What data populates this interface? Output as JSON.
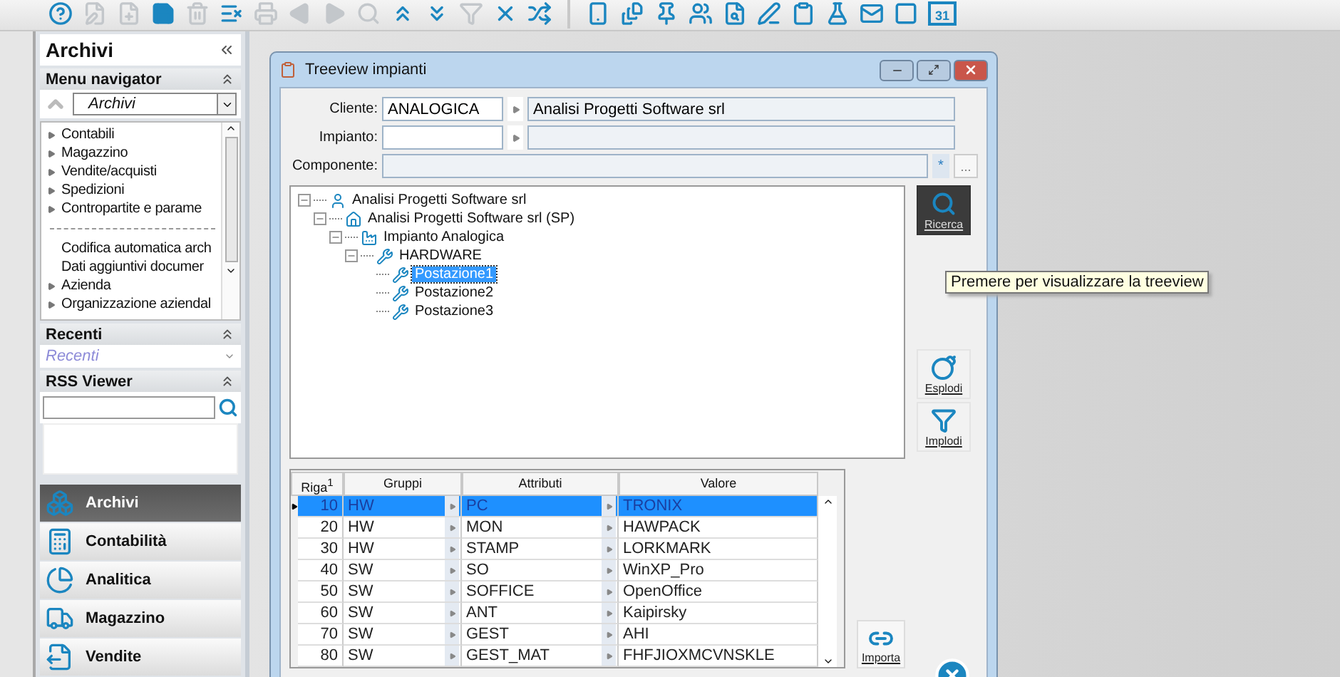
{
  "toolbar": [
    {
      "disabled": false
    },
    {
      "disabled": true
    },
    {
      "disabled": true
    },
    {
      "disabled": false
    },
    {
      "disabled": true
    },
    {
      "disabled": false
    },
    {
      "disabled": true
    },
    {
      "disabled": true
    },
    {
      "disabled": true
    },
    {
      "disabled": true
    },
    {
      "disabled": false
    },
    {
      "disabled": false
    },
    {
      "disabled": true
    },
    {
      "disabled": false
    },
    {
      "disabled": false
    },
    {
      "disabled": false
    },
    {
      "disabled": false
    },
    {
      "disabled": false
    },
    {
      "disabled": false
    },
    {
      "disabled": false
    },
    {
      "disabled": false
    },
    {
      "disabled": false
    },
    {
      "disabled": false
    },
    {
      "disabled": false
    },
    {
      "disabled": false
    }
  ],
  "toolbar_calendar_day": "31",
  "sidebar": {
    "title": "Archivi",
    "menu_navigator": {
      "title": "Menu navigator",
      "combo_value": "Archivi",
      "items": [
        {
          "label": "Contabili",
          "kind": "folder"
        },
        {
          "label": "Magazzino",
          "kind": "folder"
        },
        {
          "label": "Vendite/acquisti",
          "kind": "folder"
        },
        {
          "label": "Spedizioni",
          "kind": "folder"
        },
        {
          "label": "Contropartite e parame",
          "kind": "folder"
        },
        {
          "kind": "separator"
        },
        {
          "label": "Codifica automatica arch",
          "kind": "leaf"
        },
        {
          "label": "Dati aggiuntivi documer",
          "kind": "leaf"
        },
        {
          "label": "Azienda",
          "kind": "folder"
        },
        {
          "label": "Organizzazione aziendal",
          "kind": "folder"
        }
      ]
    },
    "recenti": {
      "title": "Recenti",
      "placeholder": "Recenti"
    },
    "rss": {
      "title": "RSS Viewer"
    },
    "nav": [
      {
        "label": "Archivi",
        "selected": true
      },
      {
        "label": "Contabilità",
        "selected": false
      },
      {
        "label": "Analitica",
        "selected": false
      },
      {
        "label": "Magazzino",
        "selected": false
      },
      {
        "label": "Vendite",
        "selected": false
      }
    ]
  },
  "dialog": {
    "title": "Treeview impianti",
    "fields": [
      {
        "label": "Cliente:",
        "kind": "lookup",
        "code": "ANALOGICA",
        "description": "Analisi Progetti Software srl"
      },
      {
        "label": "Impianto:",
        "kind": "lookup"
      },
      {
        "label": "Componente:",
        "kind": "wide",
        "marker": "*",
        "button": "..."
      }
    ],
    "tree": [
      {
        "label": "Analisi Progetti Software srl",
        "kind": "client",
        "selected": false,
        "expanded": true,
        "children": [
          {
            "label": "Analisi Progetti Software srl (SP)",
            "kind": "site",
            "selected": false,
            "expanded": true,
            "children": [
              {
                "label": "Impianto Analogica",
                "kind": "plant",
                "selected": false,
                "expanded": true,
                "children": [
                  {
                    "label": "HARDWARE",
                    "kind": "tools",
                    "selected": false,
                    "expanded": true,
                    "children": [
                      {
                        "label": "Postazione1",
                        "kind": "tools",
                        "selected": true
                      },
                      {
                        "label": "Postazione2",
                        "kind": "tools",
                        "selected": false
                      },
                      {
                        "label": "Postazione3",
                        "kind": "tools",
                        "selected": false
                      }
                    ]
                  }
                ]
              }
            ]
          }
        ]
      }
    ],
    "side_buttons": [
      {
        "label": "Ricerca",
        "kind": "search",
        "active": true
      },
      {
        "label": "Esplodi",
        "kind": "bomb",
        "active": false
      },
      {
        "label": "Implodi",
        "kind": "funnel",
        "active": false
      }
    ],
    "tooltip": "Premere per visualizzare la treeview",
    "grid": {
      "columns": [
        "Riga$^{1}$",
        "Gruppi",
        "Attributi",
        "Valore"
      ],
      "rows": [
        {
          "riga": "10",
          "gruppo": "HW",
          "attributo": "PC",
          "valore": "TRONIX",
          "selected": true
        },
        {
          "riga": "20",
          "gruppo": "HW",
          "attributo": "MON",
          "valore": "HAWPACK",
          "selected": false
        },
        {
          "riga": "30",
          "gruppo": "HW",
          "attributo": "STAMP",
          "valore": "LORKMARK",
          "selected": false
        },
        {
          "riga": "40",
          "gruppo": "SW",
          "attributo": "SO",
          "valore": "WinXP_Pro",
          "selected": false
        },
        {
          "riga": "50",
          "gruppo": "SW",
          "attributo": "SOFFICE",
          "valore": "OpenOffice",
          "selected": false
        },
        {
          "riga": "60",
          "gruppo": "SW",
          "attributo": "ANT",
          "valore": "Kaipirsky",
          "selected": false
        },
        {
          "riga": "70",
          "gruppo": "SW",
          "attributo": "GEST",
          "valore": "AHI",
          "selected": false
        },
        {
          "riga": "80",
          "gruppo": "SW",
          "attributo": "GEST_MAT",
          "valore": "FHFJIOXMCVNSKLE",
          "selected": false
        }
      ]
    },
    "import_button": "Importa"
  }
}
